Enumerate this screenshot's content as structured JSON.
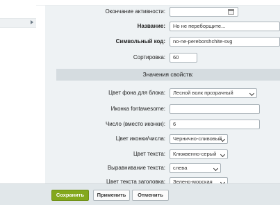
{
  "form": {
    "fields": {
      "active_to": {
        "label": "Окончание активности:",
        "value": ""
      },
      "name": {
        "label": "Название:",
        "value": "Но не переборщите..."
      },
      "code": {
        "label": "Символьный код:",
        "value": "no-ne-pereborshchite-svg"
      },
      "sort": {
        "label": "Сортировка:",
        "value": "60"
      }
    },
    "section_title": "Значения свойств:",
    "props": {
      "bg_color": {
        "label": "Цвет фона для блока:",
        "value": "Лесной волк прозрачный"
      },
      "fa_icon": {
        "label": "Иконка fontawesome:",
        "value": ""
      },
      "number": {
        "label": "Число (вместо иконки):",
        "value": "6"
      },
      "icon_color": {
        "label": "Цвет иконки/числа:",
        "value": "Чернично-сливовый"
      },
      "text_color": {
        "label": "Цвет текста:",
        "value": "Клюквенно-серый"
      },
      "text_align": {
        "label": "Выравнивание текста:",
        "value": "слева"
      },
      "title_color": {
        "label": "Цвет текста заголовка:",
        "value": "Зелено-морская"
      }
    }
  },
  "buttons": {
    "save": "Сохранить",
    "apply": "Применить",
    "cancel": "Отменить"
  },
  "icons": {
    "calendar": "calendar-icon",
    "chevron": "chevron-down-icon",
    "arrow": "triangle-right-icon"
  },
  "colors": {
    "accent": "#83a81c",
    "panel": "#eef2f4",
    "section": "#d5dce0"
  }
}
